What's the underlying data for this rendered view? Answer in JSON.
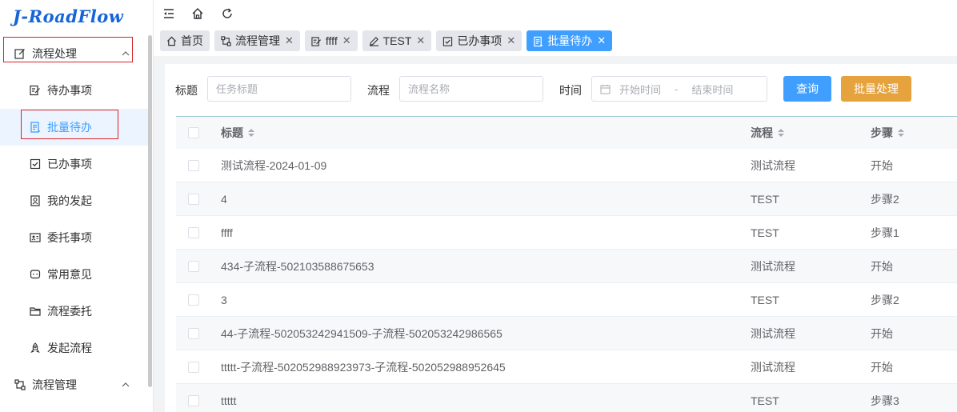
{
  "app": {
    "logo": "J-RoadFlow"
  },
  "sidebar": {
    "group1": {
      "label": "流程处理"
    },
    "items": [
      {
        "label": "待办事项",
        "icon": "edit-doc-icon"
      },
      {
        "label": "批量待办",
        "icon": "batch-doc-icon",
        "active": true
      },
      {
        "label": "已办事项",
        "icon": "checked-box-icon"
      },
      {
        "label": "我的发起",
        "icon": "user-card-icon"
      },
      {
        "label": "委托事项",
        "icon": "id-card-icon"
      },
      {
        "label": "常用意见",
        "icon": "chat-icon"
      },
      {
        "label": "流程委托",
        "icon": "folder-icon"
      },
      {
        "label": "发起流程",
        "icon": "rocket-icon"
      }
    ],
    "group2": {
      "label": "流程管理"
    }
  },
  "tabs": [
    {
      "label": "首页",
      "icon": "home-icon",
      "closable": false
    },
    {
      "label": "流程管理",
      "icon": "flow-icon",
      "closable": true
    },
    {
      "label": "ffff",
      "icon": "edit-doc-icon",
      "closable": true
    },
    {
      "label": "TEST",
      "icon": "pencil-icon",
      "closable": true
    },
    {
      "label": "已办事项",
      "icon": "checked-box-icon",
      "closable": true
    },
    {
      "label": "批量待办",
      "icon": "batch-doc-icon",
      "closable": true,
      "active": true
    }
  ],
  "tab_close_glyph": "✕",
  "filter": {
    "title_label": "标题",
    "title_placeholder": "任务标题",
    "flow_label": "流程",
    "flow_placeholder": "流程名称",
    "time_label": "时间",
    "start_placeholder": "开始时间",
    "separator": "-",
    "end_placeholder": "结束时间",
    "query_button": "查询",
    "batch_button": "批量处理"
  },
  "table": {
    "headers": {
      "title": "标题",
      "flow": "流程",
      "step": "步骤"
    },
    "rows": [
      {
        "title": "测试流程-2024-01-09",
        "flow": "测试流程",
        "step": "开始"
      },
      {
        "title": "4",
        "flow": "TEST",
        "step": "步骤2"
      },
      {
        "title": "ffff",
        "flow": "TEST",
        "step": "步骤1"
      },
      {
        "title": "434-子流程-502103588675653",
        "flow": "测试流程",
        "step": "开始"
      },
      {
        "title": "3",
        "flow": "TEST",
        "step": "步骤2"
      },
      {
        "title": "44-子流程-502053242941509-子流程-502053242986565",
        "flow": "测试流程",
        "step": "开始"
      },
      {
        "title": "ttttt-子流程-502052988923973-子流程-502052988952645",
        "flow": "测试流程",
        "step": "开始"
      },
      {
        "title": "ttttt",
        "flow": "TEST",
        "step": "步骤3"
      }
    ]
  },
  "colors": {
    "primary": "#409eff",
    "warning": "#e6a23c",
    "logo": "#1565d8",
    "annotation": "#d9222a"
  }
}
